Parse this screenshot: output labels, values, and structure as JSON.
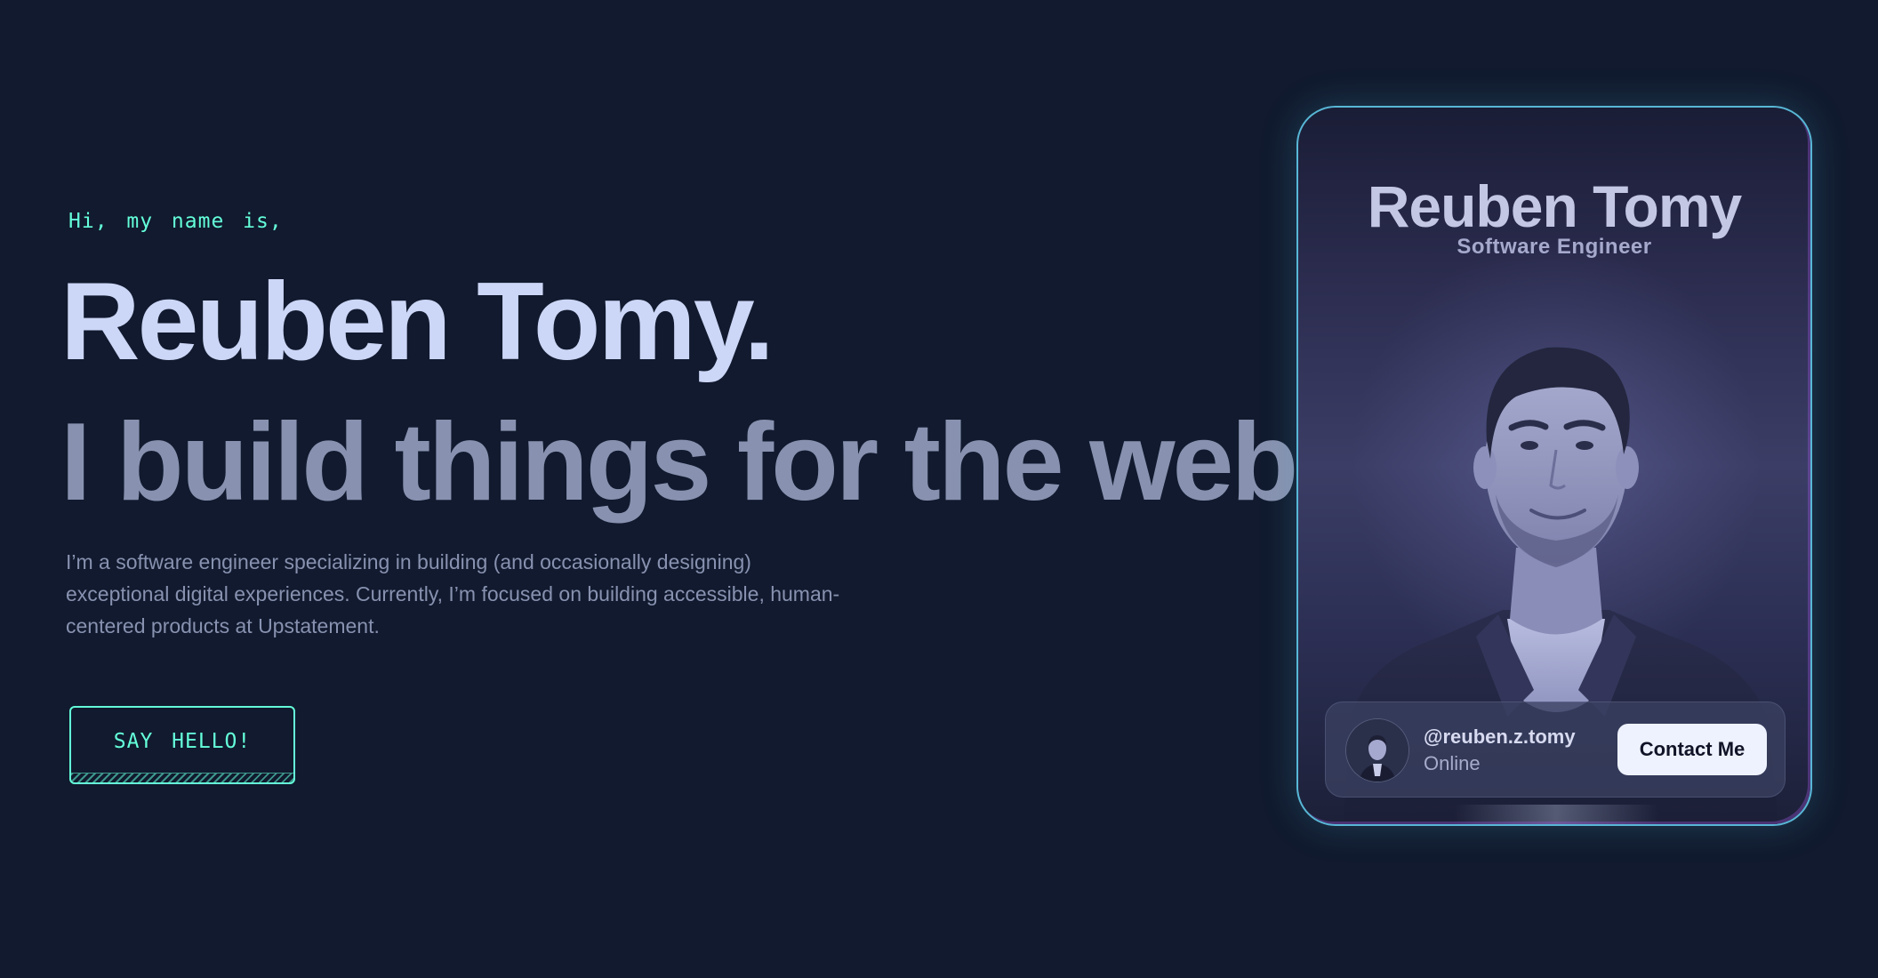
{
  "hero": {
    "greeting": "Hi, my name is,",
    "name": "Reuben Tomy.",
    "tagline": "I build things for the web.",
    "description": "I’m a software engineer specializing in building (and occasionally designing) exceptional digital experiences. Currently, I’m focused on building accessible, human-centered products at Upstatement.",
    "cta_label": "SAY HELLO!"
  },
  "card": {
    "name": "Reuben Tomy",
    "role": "Software Engineer",
    "handle": "@reuben.z.tomy",
    "status": "Online",
    "contact_label": "Contact Me"
  },
  "colors": {
    "background": "#111a2e",
    "accent": "#64ffda",
    "heading": "#ccd6f6",
    "muted": "#8892b0",
    "card_border": "#58b7d6"
  }
}
